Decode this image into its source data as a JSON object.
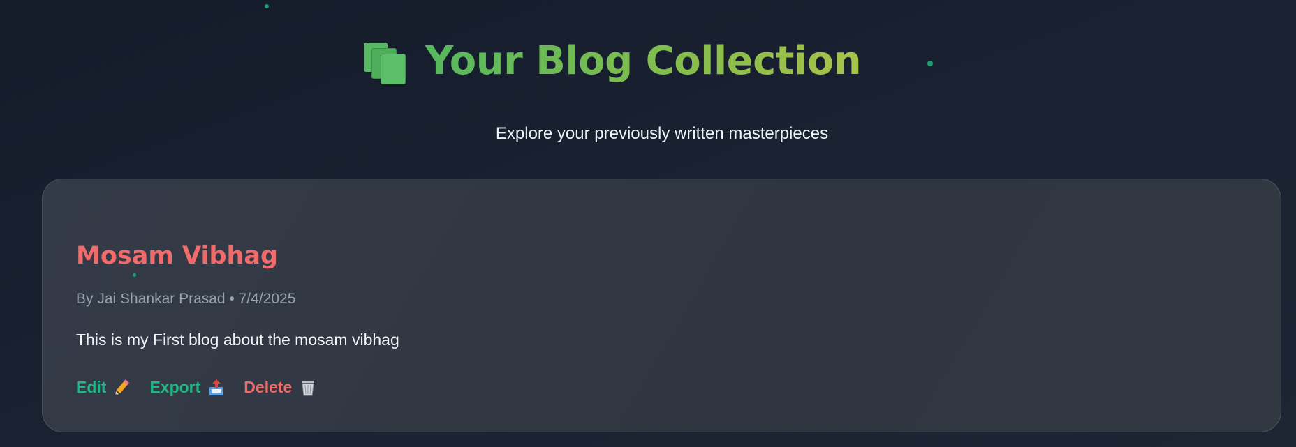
{
  "header": {
    "icon": "card-index-dividers-icon",
    "title": "Your Blog Collection",
    "subtitle": "Explore your previously written masterpieces"
  },
  "blogs": [
    {
      "title": "Mosam Vibhag",
      "meta": "By Jai Shankar Prasad • 7/4/2025",
      "excerpt": "This is my First blog about the mosam vibhag",
      "actions": {
        "edit_label": "Edit",
        "edit_icon": "pencil-icon",
        "export_label": "Export",
        "export_icon": "outbox-tray-icon",
        "delete_label": "Delete",
        "delete_icon": "wastebasket-icon"
      }
    }
  ],
  "colors": {
    "background": "#171e2b",
    "card": "#333a46",
    "title_gradient_start": "#56b85e",
    "title_gradient_end": "#a8c24a",
    "blog_title": "#f26b6b",
    "action_green": "#22b585",
    "action_red": "#f26b6b",
    "dot": "#1f9d6f"
  }
}
